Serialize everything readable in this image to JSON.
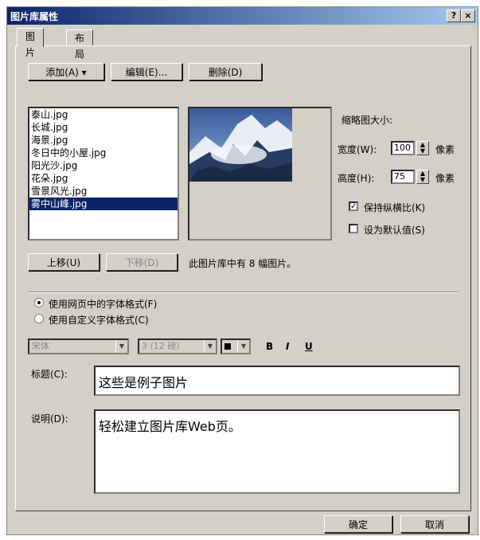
{
  "window": {
    "title": "图片库属性",
    "help": "?",
    "close": "×"
  },
  "tabs": [
    {
      "label": "图片"
    },
    {
      "label": "布局"
    }
  ],
  "toolbar": {
    "add": "添加(A) ▾",
    "edit": "编辑(E)...",
    "delete": "删除(D)"
  },
  "images": [
    "泰山.jpg",
    "长城.jpg",
    "海景.jpg",
    "冬日中的小屋.jpg",
    "阳光沙.jpg",
    "花朵.jpg",
    "雪景风光.jpg",
    "雾中山峰.jpg"
  ],
  "selected_index": 7,
  "thumbnail": {
    "heading": "缩略图大小:",
    "width_label": "宽度(W):",
    "width_value": "100",
    "height_label": "高度(H):",
    "height_value": "75",
    "unit": "像素",
    "keep_ratio_label": "保持纵横比(K)",
    "keep_ratio_checked": true,
    "default_label": "设为默认值(S)",
    "default_checked": false
  },
  "move": {
    "up": "上移(U)",
    "down": "下移(D)",
    "count_text": "此图片库中有 8 幅图片。"
  },
  "font": {
    "option1": "使用网页中的字体格式(F)",
    "option2": "使用自定义字体格式(C)",
    "face": "宋体",
    "size": "3 (12 磅)",
    "bold": "B",
    "italic": "I",
    "underline": "U"
  },
  "caption": {
    "label": "标题(C):",
    "value": "这些是例子图片"
  },
  "description": {
    "label": "说明(D):",
    "value": "轻松建立图片库Web页。"
  },
  "footer": {
    "ok": "确定",
    "cancel": "取消"
  }
}
